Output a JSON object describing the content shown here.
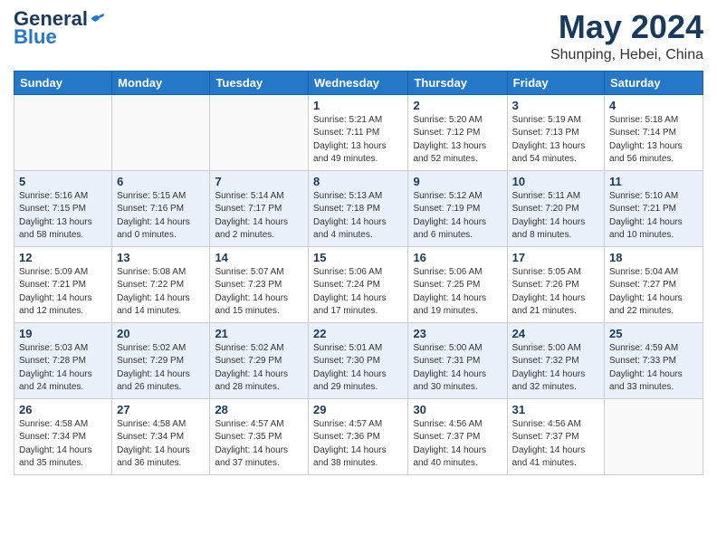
{
  "header": {
    "logo_general": "General",
    "logo_blue": "Blue",
    "month": "May 2024",
    "location": "Shunping, Hebei, China"
  },
  "weekdays": [
    "Sunday",
    "Monday",
    "Tuesday",
    "Wednesday",
    "Thursday",
    "Friday",
    "Saturday"
  ],
  "weeks": [
    [
      {
        "day": "",
        "info": ""
      },
      {
        "day": "",
        "info": ""
      },
      {
        "day": "",
        "info": ""
      },
      {
        "day": "1",
        "info": "Sunrise: 5:21 AM\nSunset: 7:11 PM\nDaylight: 13 hours\nand 49 minutes."
      },
      {
        "day": "2",
        "info": "Sunrise: 5:20 AM\nSunset: 7:12 PM\nDaylight: 13 hours\nand 52 minutes."
      },
      {
        "day": "3",
        "info": "Sunrise: 5:19 AM\nSunset: 7:13 PM\nDaylight: 13 hours\nand 54 minutes."
      },
      {
        "day": "4",
        "info": "Sunrise: 5:18 AM\nSunset: 7:14 PM\nDaylight: 13 hours\nand 56 minutes."
      }
    ],
    [
      {
        "day": "5",
        "info": "Sunrise: 5:16 AM\nSunset: 7:15 PM\nDaylight: 13 hours\nand 58 minutes."
      },
      {
        "day": "6",
        "info": "Sunrise: 5:15 AM\nSunset: 7:16 PM\nDaylight: 14 hours\nand 0 minutes."
      },
      {
        "day": "7",
        "info": "Sunrise: 5:14 AM\nSunset: 7:17 PM\nDaylight: 14 hours\nand 2 minutes."
      },
      {
        "day": "8",
        "info": "Sunrise: 5:13 AM\nSunset: 7:18 PM\nDaylight: 14 hours\nand 4 minutes."
      },
      {
        "day": "9",
        "info": "Sunrise: 5:12 AM\nSunset: 7:19 PM\nDaylight: 14 hours\nand 6 minutes."
      },
      {
        "day": "10",
        "info": "Sunrise: 5:11 AM\nSunset: 7:20 PM\nDaylight: 14 hours\nand 8 minutes."
      },
      {
        "day": "11",
        "info": "Sunrise: 5:10 AM\nSunset: 7:21 PM\nDaylight: 14 hours\nand 10 minutes."
      }
    ],
    [
      {
        "day": "12",
        "info": "Sunrise: 5:09 AM\nSunset: 7:21 PM\nDaylight: 14 hours\nand 12 minutes."
      },
      {
        "day": "13",
        "info": "Sunrise: 5:08 AM\nSunset: 7:22 PM\nDaylight: 14 hours\nand 14 minutes."
      },
      {
        "day": "14",
        "info": "Sunrise: 5:07 AM\nSunset: 7:23 PM\nDaylight: 14 hours\nand 15 minutes."
      },
      {
        "day": "15",
        "info": "Sunrise: 5:06 AM\nSunset: 7:24 PM\nDaylight: 14 hours\nand 17 minutes."
      },
      {
        "day": "16",
        "info": "Sunrise: 5:06 AM\nSunset: 7:25 PM\nDaylight: 14 hours\nand 19 minutes."
      },
      {
        "day": "17",
        "info": "Sunrise: 5:05 AM\nSunset: 7:26 PM\nDaylight: 14 hours\nand 21 minutes."
      },
      {
        "day": "18",
        "info": "Sunrise: 5:04 AM\nSunset: 7:27 PM\nDaylight: 14 hours\nand 22 minutes."
      }
    ],
    [
      {
        "day": "19",
        "info": "Sunrise: 5:03 AM\nSunset: 7:28 PM\nDaylight: 14 hours\nand 24 minutes."
      },
      {
        "day": "20",
        "info": "Sunrise: 5:02 AM\nSunset: 7:29 PM\nDaylight: 14 hours\nand 26 minutes."
      },
      {
        "day": "21",
        "info": "Sunrise: 5:02 AM\nSunset: 7:29 PM\nDaylight: 14 hours\nand 28 minutes."
      },
      {
        "day": "22",
        "info": "Sunrise: 5:01 AM\nSunset: 7:30 PM\nDaylight: 14 hours\nand 29 minutes."
      },
      {
        "day": "23",
        "info": "Sunrise: 5:00 AM\nSunset: 7:31 PM\nDaylight: 14 hours\nand 30 minutes."
      },
      {
        "day": "24",
        "info": "Sunrise: 5:00 AM\nSunset: 7:32 PM\nDaylight: 14 hours\nand 32 minutes."
      },
      {
        "day": "25",
        "info": "Sunrise: 4:59 AM\nSunset: 7:33 PM\nDaylight: 14 hours\nand 33 minutes."
      }
    ],
    [
      {
        "day": "26",
        "info": "Sunrise: 4:58 AM\nSunset: 7:34 PM\nDaylight: 14 hours\nand 35 minutes."
      },
      {
        "day": "27",
        "info": "Sunrise: 4:58 AM\nSunset: 7:34 PM\nDaylight: 14 hours\nand 36 minutes."
      },
      {
        "day": "28",
        "info": "Sunrise: 4:57 AM\nSunset: 7:35 PM\nDaylight: 14 hours\nand 37 minutes."
      },
      {
        "day": "29",
        "info": "Sunrise: 4:57 AM\nSunset: 7:36 PM\nDaylight: 14 hours\nand 38 minutes."
      },
      {
        "day": "30",
        "info": "Sunrise: 4:56 AM\nSunset: 7:37 PM\nDaylight: 14 hours\nand 40 minutes."
      },
      {
        "day": "31",
        "info": "Sunrise: 4:56 AM\nSunset: 7:37 PM\nDaylight: 14 hours\nand 41 minutes."
      },
      {
        "day": "",
        "info": ""
      }
    ]
  ]
}
